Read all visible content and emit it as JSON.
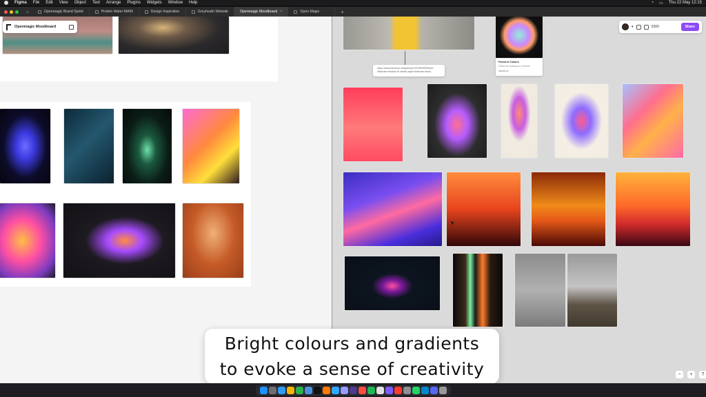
{
  "menubar": {
    "app": "Figma",
    "items": [
      "File",
      "Edit",
      "View",
      "Object",
      "Text",
      "Arrange",
      "Plugins",
      "Widgets",
      "Window",
      "Help"
    ],
    "datetime": "Thu 22 May 12:15"
  },
  "tabs": [
    {
      "label": "Openmagic Brand Sprint",
      "active": false
    },
    {
      "label": "Protein Water MAIN",
      "active": false
    },
    {
      "label": "Design Inspiration",
      "active": false
    },
    {
      "label": "Greyheath Website",
      "active": false
    },
    {
      "label": "Openmagic Moodboard",
      "active": true
    },
    {
      "label": "Open Magic",
      "active": false
    }
  ],
  "file_label": "Openmagic Moodboard",
  "toolbar": {
    "zoom": "0300",
    "share": "Share"
  },
  "link_card": {
    "text": "https://www.behance.net/gallery/193780909/Hinterl... Hinterlaw festival art artistic style/Hinterlaw-festiv..."
  },
  "found_card": {
    "title": "Found in Colours",
    "desc": "Follow the reading your moment",
    "site": "colours.co"
  },
  "caption": {
    "line1": "Bright colours and gradients",
    "line2": "to evoke a sense of creativity"
  },
  "zoom_controls": {
    "minus": "−",
    "plus": "+",
    "help": "?"
  },
  "colors": {
    "accent": "#8d4bf6"
  }
}
